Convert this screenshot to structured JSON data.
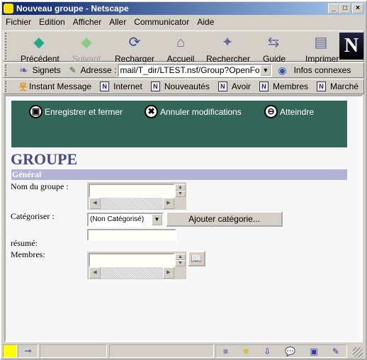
{
  "window": {
    "title": "Nouveau groupe - Netscape",
    "minimize": "_",
    "maximize": "□",
    "close": "×"
  },
  "menu": [
    "Fichier",
    "Edition",
    "Afficher",
    "Aller",
    "Communicator",
    "Aide"
  ],
  "nav": [
    {
      "label": "Précédent",
      "icon": "back-arrow-icon"
    },
    {
      "label": "Suivant",
      "icon": "forward-arrow-icon"
    },
    {
      "label": "Recharger",
      "icon": "reload-icon"
    },
    {
      "label": "Accueil",
      "icon": "home-icon"
    },
    {
      "label": "Rechercher",
      "icon": "search-flashlight-icon"
    },
    {
      "label": "Guide",
      "icon": "signpost-icon"
    },
    {
      "label": "Imprimer",
      "icon": "printer-icon"
    }
  ],
  "logo": "N",
  "location": {
    "bookmarks": "Signets",
    "address_label": "Adresse :",
    "url": "mail/T_dir/LTEST.nsf/Group?OpenForm",
    "related": "Infos connexes"
  },
  "personal": [
    "Instant Message",
    "Internet",
    "Nouveautés",
    "Avoir",
    "Membres",
    "Marché"
  ],
  "form": {
    "actions": [
      {
        "label": "Enregistrer et fermer",
        "icon": "save-disk-icon"
      },
      {
        "label": "Annuler modifications",
        "icon": "cancel-x-icon"
      },
      {
        "label": "Atteindre",
        "icon": "goto-signpost-icon"
      }
    ],
    "title": "GROUPE",
    "section": "Général",
    "group_name_label": "Nom du groupe :",
    "group_name": "",
    "categorize_label": "Catégoriser :",
    "category": "(Non Catégorisé)",
    "add_category": "Ajouter catégorie...",
    "new_category": "",
    "summary_label": "résumé:",
    "members_label": "Membres:",
    "members": ""
  },
  "colors": {
    "banner": "#336659",
    "title": "#4a4a8a",
    "section": "#b3b3d6"
  }
}
